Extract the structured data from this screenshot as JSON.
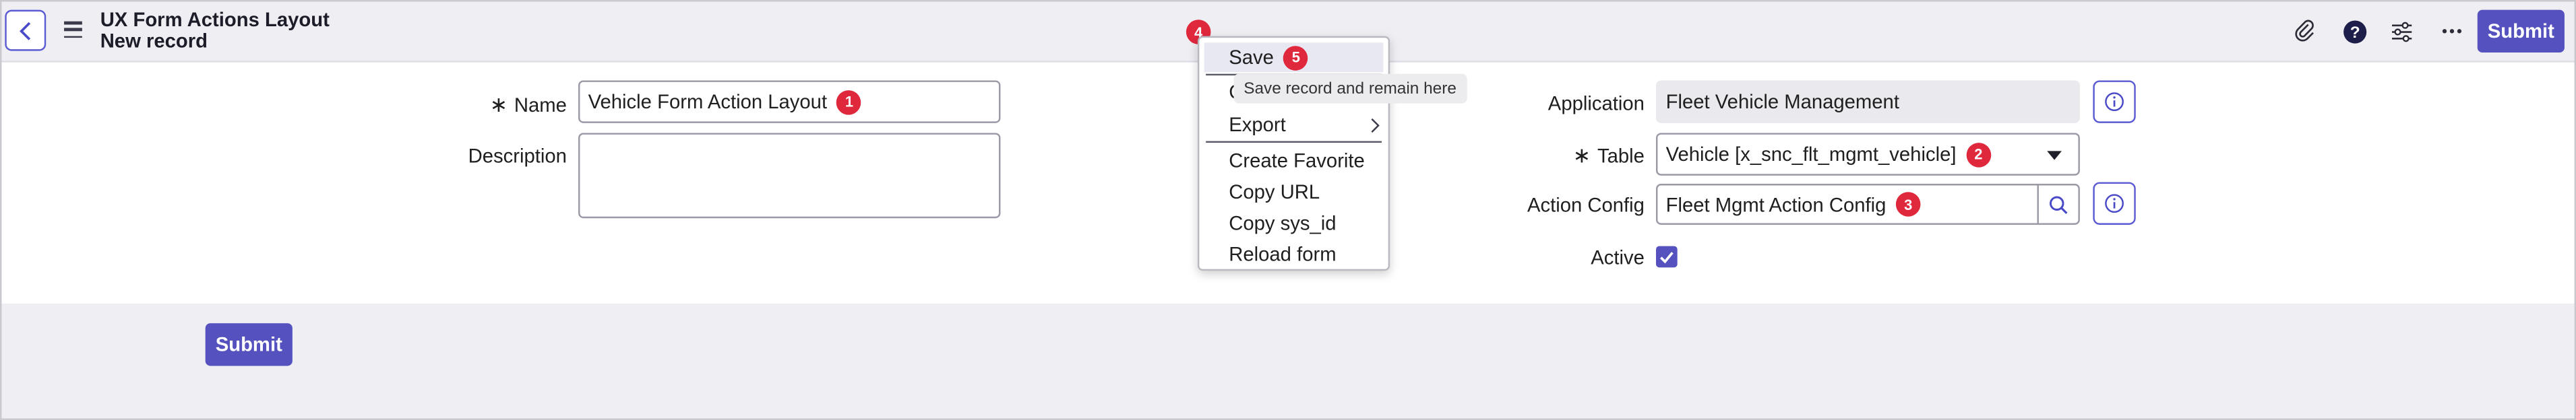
{
  "header": {
    "title": "UX Form Actions Layout",
    "subtitle": "New record",
    "submit_label": "Submit",
    "icons": [
      "back-icon",
      "menu-icon",
      "paperclip-icon",
      "help-icon",
      "sliders-icon",
      "more-icon"
    ]
  },
  "form": {
    "name_label": "Name",
    "name_value": "Vehicle Form Action Layout",
    "description_label": "Description",
    "description_value": "",
    "application_label": "Application",
    "application_value": "Fleet Vehicle Management",
    "table_label": "Table",
    "table_value": "Vehicle [x_snc_flt_mgmt_vehicle]",
    "action_config_label": "Action Config",
    "action_config_value": "Fleet Mgmt Action Config",
    "active_label": "Active",
    "active_checked": true,
    "required_marker": "∗"
  },
  "footer": {
    "submit_label": "Submit"
  },
  "context_menu": {
    "items": [
      "Save",
      "C",
      "Export",
      "Create Favorite",
      "Copy URL",
      "Copy sys_id",
      "Reload form"
    ],
    "tooltip": "Save record and remain here"
  },
  "badges": {
    "b1": "1",
    "b2": "2",
    "b3": "3",
    "b4": "4",
    "b5": "5"
  },
  "colors": {
    "accent": "#5552bf",
    "badge": "#e0283d",
    "header_bg": "#efeff3"
  }
}
